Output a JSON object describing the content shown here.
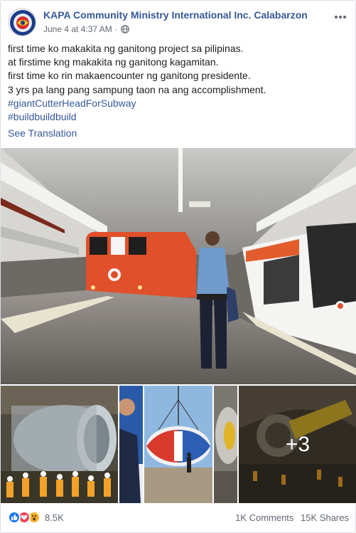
{
  "post": {
    "page_name": "KAPA Community Ministry International Inc. Calabarzon",
    "timestamp": "June 4 at 4:37 AM",
    "meta_separator": "·",
    "privacy_icon": "globe-icon",
    "more_icon": "more-options-icon",
    "text_lines": [
      "first time ko makakita ng ganitong project sa pilipinas.",
      "at firstime kng makakita ng ganitong kagamitan.",
      "first time ko rin makaencounter ng ganitong presidente.",
      "3 yrs pa lang pang sampung taon na ang accomplishment."
    ],
    "hashtags": [
      "#giantCutterHeadForSubway",
      "#buildbuildbuild"
    ],
    "see_translation": "See Translation"
  },
  "gallery": {
    "more_count": "+3"
  },
  "footer": {
    "reaction_icons": [
      "like-icon",
      "love-icon",
      "wow-icon"
    ],
    "reaction_count": "8.5K",
    "comments": "1K Comments",
    "shares": "15K Shares"
  },
  "colors": {
    "link": "#365899",
    "secondary_text": "#616770",
    "like": "#1877f2",
    "love": "#f33e58",
    "wow": "#f7b125"
  }
}
